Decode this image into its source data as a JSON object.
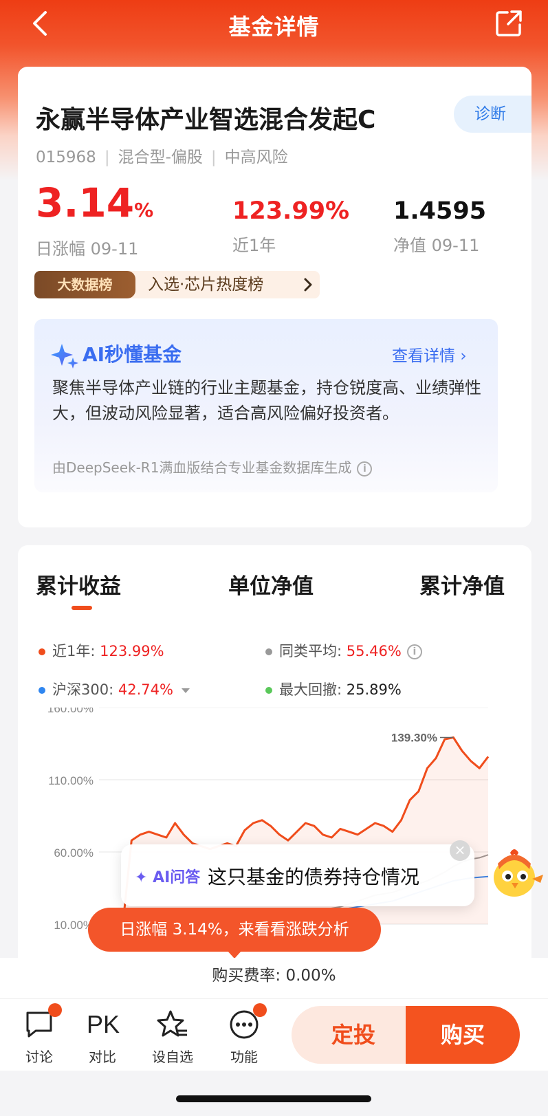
{
  "nav": {
    "title": "基金详情"
  },
  "fund": {
    "name": "永赢半导体产业智选混合发起C",
    "diagnose_label": "诊断",
    "code": "015968",
    "type": "混合型-偏股",
    "risk": "中高风险",
    "daily_change_value": "3.14",
    "daily_change_unit": "%",
    "daily_change_label": "日涨幅 09-11",
    "year_return": "123.99%",
    "year_return_label": "近1年",
    "nav_value": "1.4595",
    "nav_label": "净值 09-11",
    "rank_tag": "大数据榜",
    "rank_text": "入选·芯片热度榜"
  },
  "ai": {
    "title": "AI秒懂基金",
    "more_label": "查看详情",
    "summary": "聚焦半导体产业链的行业主题基金，持仓锐度高、业绩弹性大，但波动风险显著，适合高风险偏好投资者。",
    "source": "由DeepSeek-R1满血版结合专业基金数据库生成"
  },
  "chart_section": {
    "tabs": [
      "累计收益",
      "单位净值",
      "累计净值"
    ],
    "legend": [
      {
        "label": "近1年: ",
        "value": "123.99%",
        "color": "#f04d1c"
      },
      {
        "label": "同类平均: ",
        "value": "55.46%",
        "color": "#999999"
      },
      {
        "label": "沪深300: ",
        "value": "42.74%",
        "color": "#2f86f0"
      },
      {
        "label": "最大回撤: ",
        "value": "25.89%",
        "color": "#5ac85a"
      }
    ]
  },
  "chart_data": {
    "type": "line",
    "yticks": [
      "160.00%",
      "110.00%",
      "60.00%",
      "10.00%"
    ],
    "ylim": [
      10,
      160
    ],
    "peak_annotation": "139.30%",
    "series": [
      {
        "name": "近1年",
        "color": "#f04d1c",
        "values": [
          2,
          10,
          68,
          72,
          74,
          72,
          70,
          80,
          72,
          66,
          64,
          62,
          64,
          66,
          64,
          75,
          80,
          82,
          78,
          72,
          68,
          74,
          80,
          78,
          72,
          70,
          76,
          74,
          72,
          76,
          80,
          78,
          74,
          82,
          96,
          102,
          118,
          125,
          138,
          139.3,
          130,
          123,
          118,
          126
        ]
      },
      {
        "name": "同类平均",
        "color": "#9a9a9a",
        "values": [
          2,
          6,
          10,
          12,
          13,
          12,
          13,
          14,
          13,
          12,
          12,
          13,
          14,
          15,
          15,
          16,
          17,
          18,
          17,
          16,
          17,
          18,
          19,
          20,
          20,
          21,
          22,
          24,
          26,
          28,
          30,
          31,
          32,
          34,
          36,
          38,
          40,
          43,
          46,
          50,
          53,
          55,
          56,
          58
        ]
      },
      {
        "name": "沪深300",
        "color": "#2f86f0",
        "values": [
          2,
          4,
          6,
          8,
          9,
          8,
          9,
          10,
          9,
          9,
          10,
          10,
          11,
          12,
          12,
          13,
          14,
          15,
          14,
          14,
          15,
          16,
          17,
          18,
          18,
          19,
          20,
          21,
          22,
          23,
          24,
          25,
          26,
          28,
          30,
          32,
          34,
          36,
          38,
          40,
          41,
          42,
          42.5,
          43
        ]
      }
    ]
  },
  "ask": {
    "tag": "AI问答",
    "question": "这只基金的债券持仓情况"
  },
  "rise_tip": "日涨幅 3.14%，来看看涨跌分析",
  "fee": "购买费率: 0.00%",
  "toolbar": {
    "discuss": "讨论",
    "pk_glyph": "PK",
    "compare": "对比",
    "watch": "设自选",
    "functions": "功能",
    "dingtou": "定投",
    "buy": "购买"
  }
}
